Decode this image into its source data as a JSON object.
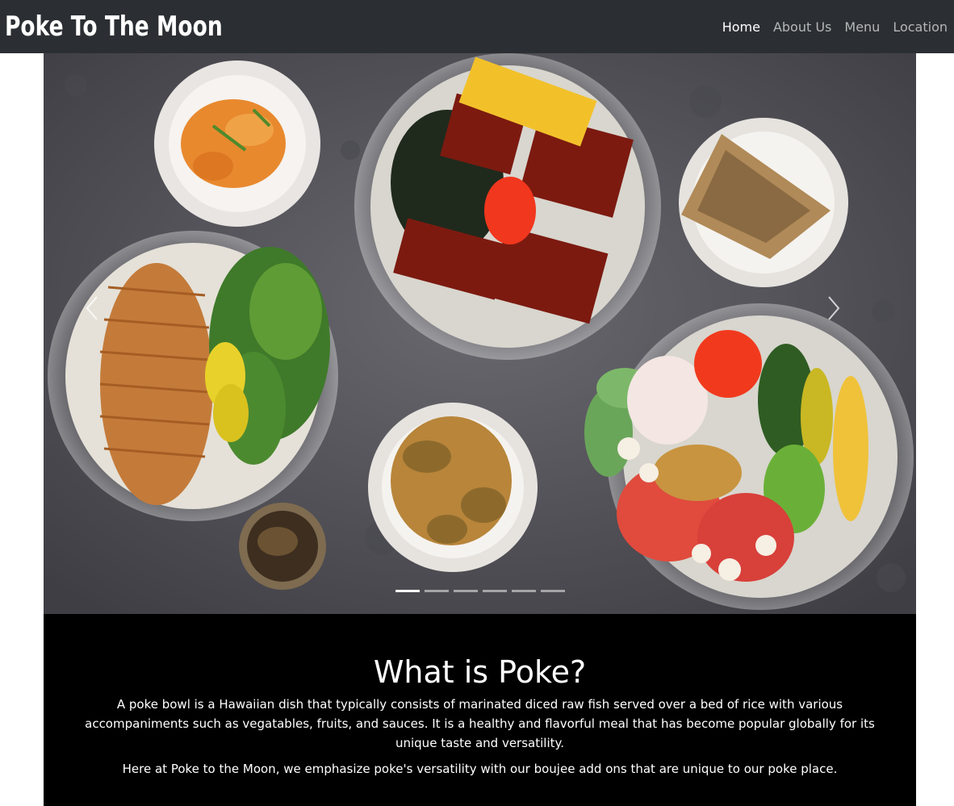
{
  "navbar": {
    "brand": "Poke To The Moon",
    "links": [
      {
        "label": "Home",
        "active": true
      },
      {
        "label": "About Us",
        "active": false
      },
      {
        "label": "Menu",
        "active": false
      },
      {
        "label": "Location",
        "active": false
      }
    ]
  },
  "carousel": {
    "slide_count": 6,
    "active_slide": 1,
    "prev_icon": "chevron-left-icon",
    "next_icon": "chevron-right-icon"
  },
  "about": {
    "heading": "What is Poke?",
    "paragraph_1": "A poke bowl is a Hawaiian dish that typically consists of marinated diced raw fish served over a bed of rice with various accompaniments such as vegatables, fruits, and sauces. It is a healthy and flavorful meal that has become popular globally for its unique taste and versatility.",
    "paragraph_2": "Here at Poke to the Moon, we emphasize poke's versatility with our boujee add ons that are unique to our poke place."
  },
  "colors": {
    "navbar_bg": "#2b2f33",
    "nav_active": "#ffffff",
    "nav_inactive": "#b4b6b8",
    "about_bg": "#000000"
  }
}
